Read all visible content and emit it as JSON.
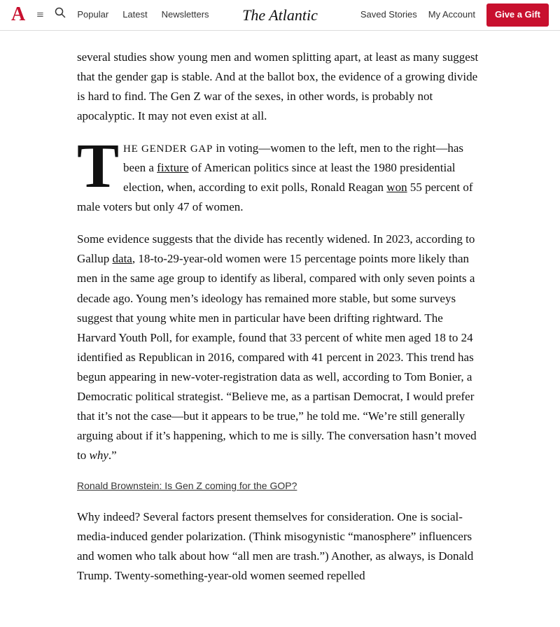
{
  "header": {
    "logo_a": "A",
    "site_title": "The Atlantic",
    "nav_items": [
      "Popular",
      "Latest",
      "Newsletters"
    ],
    "right_items": [
      "Saved Stories",
      "My Account"
    ],
    "give_gift_label": "Give a Gift"
  },
  "article": {
    "paragraph_intro": "several studies show young men and women splitting apart, at least as many suggest that the gender gap is stable. And at the ballot box, the evidence of a growing divide is hard to find. The Gen Z war of the sexes, in other words, is probably not apocalyptic. It may not even exist at all.",
    "drop_cap_letter": "T",
    "drop_cap_small_caps": "HE GENDER GAP",
    "drop_cap_rest": " in voting—women to the left, men to the right—has been a ",
    "fixture_link": "fixture",
    "drop_cap_after_link": " of American politics since at least the 1980 presidential election, when, according to exit polls, Ronald Reagan ",
    "won_link": "won",
    "drop_cap_end": " 55 percent of male voters but only 47 of women.",
    "paragraph_2_start": "Some evidence suggests that the divide has recently widened. In 2023, according to Gallup ",
    "data_link": "data",
    "paragraph_2_rest": ", 18-to-29-year-old women were 15 percentage points more likely than men in the same age group to identify as liberal, compared with only seven points a decade ago. Young men’s ideology has remained more stable, but some surveys suggest that young white men in particular have been drifting rightward. The Harvard Youth Poll, for example, found that 33 percent of white men aged 18 to 24 identified as Republican in 2016, compared with 41 percent in 2023. This trend has begun appearing in new-voter-registration data as well, according to Tom Bonier, a Democratic political strategist. “Believe me, as a partisan Democrat, I would prefer that it’s not the case—but it appears to be true,” he told me. “We’re still generally arguing about if it’s happening, which to me is silly. The conversation hasn’t moved to ",
    "why_italic": "why",
    "paragraph_2_end": ".”",
    "related_link_text": "Ronald Brownstein: Is Gen Z coming for the GOP?",
    "paragraph_3": "Why indeed? Several factors present themselves for consideration. One is social-media-induced gender polarization. (Think misogynistic “manosphere” influencers and women who talk about how “all men are trash.”) Another, as always, is Donald Trump. Twenty-something-year-old women seemed repelled"
  }
}
